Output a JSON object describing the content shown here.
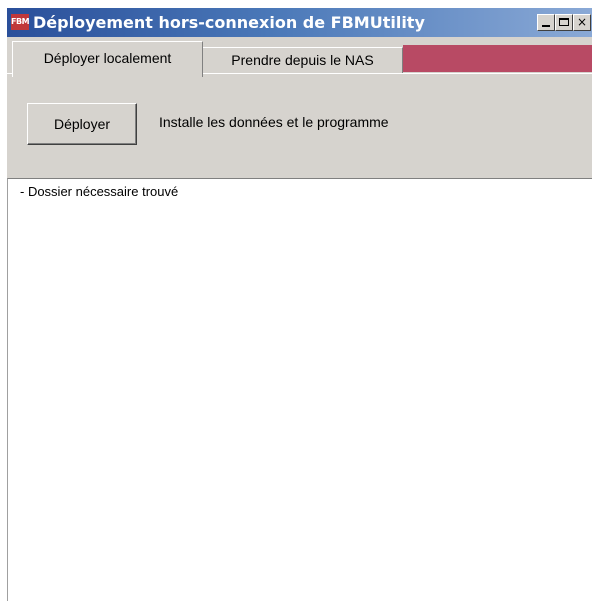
{
  "window": {
    "title": "Déployement hors-connexion de FBMUtility",
    "icon_label": "FBM",
    "controls": {
      "minimize": "",
      "maximize": "",
      "close": "×"
    }
  },
  "tabs": [
    {
      "label": "Déployer localement",
      "active": true
    },
    {
      "label": "Prendre depuis le NAS",
      "active": false
    }
  ],
  "panel": {
    "deploy_button": "Déployer",
    "description": "Installe les données et le programme"
  },
  "log": {
    "lines": [
      "- Dossier nécessaire trouvé"
    ]
  },
  "colors": {
    "titlebar_start": "#2a4f9a",
    "titlebar_end": "#8aa9d6",
    "tab_strip_accent": "#b84a64",
    "face": "#d6d3ce"
  }
}
